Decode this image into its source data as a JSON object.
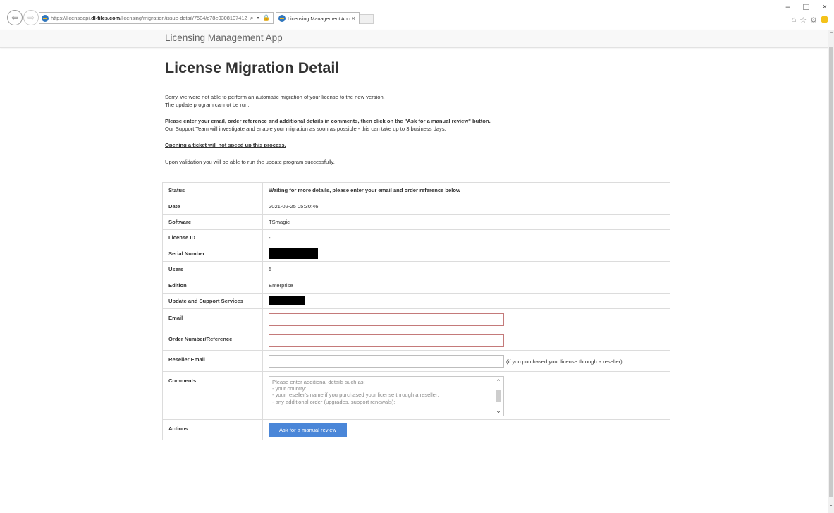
{
  "browser": {
    "url_prefix": "https://licenseapi.",
    "url_host": "dl-files.com",
    "url_path": "/licensing/migration/issue-detail/7504/c78e0308107412",
    "address_icons": "⌕ ▾ 🔒 ↻",
    "tab_title": "Licensing Management App",
    "tab_close": "×",
    "minimize": "–",
    "restore": "❐",
    "close": "×",
    "home_icon": "⌂",
    "star_icon": "☆",
    "gear_icon": "⚙"
  },
  "app": {
    "brand": "Licensing Management App"
  },
  "page": {
    "title": "License Migration Detail",
    "intro_line1": "Sorry, we were not able to perform an automatic migration of your license to the new version.",
    "intro_line2": "The update program cannot be run.",
    "instruction_bold": "Please enter your email, order reference and additional details in comments, then click on the \"Ask for a manual review\" button.",
    "instruction_line2": "Our Support Team will investigate and enable your migration as soon as possible - this can take up to 3 business days.",
    "warning": "Opening a ticket will not speed up this process.",
    "validation_note": "Upon validation you will be able to run the update program successfully."
  },
  "table": {
    "status_label": "Status",
    "status_value": "Waiting for more details, please enter your email and order reference below",
    "date_label": "Date",
    "date_value": "2021-02-25 05:30:46",
    "software_label": "Software",
    "software_value": "TSmagic",
    "license_id_label": "License ID",
    "license_id_value": "-",
    "serial_label": "Serial Number",
    "users_label": "Users",
    "users_value": "5",
    "edition_label": "Edition",
    "edition_value": "Enterprise",
    "support_label": "Update and Support Services",
    "email_label": "Email",
    "email_value": "",
    "order_label": "Order Number/Reference",
    "order_value": "",
    "reseller_label": "Reseller Email",
    "reseller_value": "",
    "reseller_hint": "(if you purchased your license through a reseller)",
    "comments_label": "Comments",
    "comments_placeholder": "Please enter additional details such as:\n- your country:\n- your reseller's name if you purchased your license through a reseller:\n- any additional order (upgrades, support renewals):",
    "actions_label": "Actions",
    "review_button": "Ask for a manual review"
  },
  "colors": {
    "button_bg": "#4a86d8",
    "required_border": "#c47a7a",
    "header_bg": "#f8f8f8"
  }
}
